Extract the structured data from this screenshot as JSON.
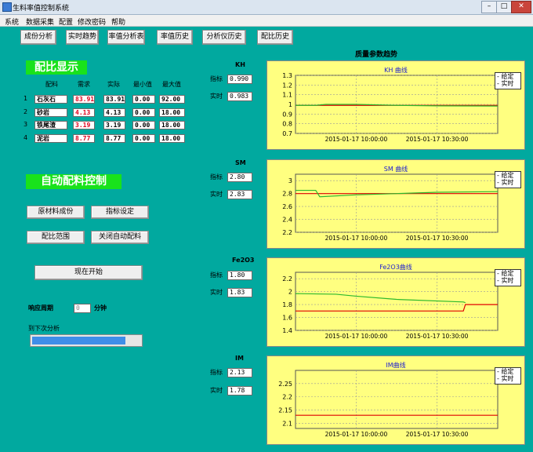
{
  "window": {
    "title": "生料率值控制系统",
    "min": "–",
    "max": "□",
    "close": "✕"
  },
  "menu": [
    "系统",
    "数据采集",
    "配置",
    "修改密码",
    "帮助"
  ],
  "toolbar": [
    "成份分析",
    "实时趋势",
    "率值分析表",
    "率值历史",
    "分析仪历史",
    "配比历史"
  ],
  "ratio": {
    "title": "配比显示",
    "headers": [
      "配料",
      "需求",
      "实际",
      "最小值",
      "最大值"
    ],
    "rows": [
      {
        "no": "1",
        "name": "石灰石",
        "demand": "83.91",
        "actual": "83.91",
        "min": "0.00",
        "max": "92.00"
      },
      {
        "no": "2",
        "name": "砂岩",
        "demand": "4.13",
        "actual": "4.13",
        "min": "0.00",
        "max": "18.00"
      },
      {
        "no": "3",
        "name": "铁尾渣",
        "demand": "3.19",
        "actual": "3.19",
        "min": "0.00",
        "max": "18.00"
      },
      {
        "no": "4",
        "name": "泥岩",
        "demand": "8.77",
        "actual": "8.77",
        "min": "0.00",
        "max": "18.00"
      }
    ]
  },
  "auto": {
    "title": "自动配料控制",
    "buttons": [
      "原材料成份",
      "指标设定",
      "配比范围",
      "关闭自动配料"
    ],
    "start": "现在开始",
    "period_label": "响应周期",
    "period_value": "0",
    "period_unit": "分钟",
    "next_label": "到下次分析",
    "progress": 0.88
  },
  "trend_title": "质量参数趋势",
  "panels": [
    {
      "param": "KH",
      "target_label": "指标",
      "target": "0.990",
      "actual_label": "实时",
      "actual": "0.983",
      "chart_title": "KH 曲线"
    },
    {
      "param": "SM",
      "target_label": "指标",
      "target": "2.80",
      "actual_label": "实时",
      "actual": "2.83",
      "chart_title": "SM 曲线"
    },
    {
      "param": "Fe2O3",
      "target_label": "指标",
      "target": "1.80",
      "actual_label": "实时",
      "actual": "1.83",
      "chart_title": "Fe2O3曲线"
    },
    {
      "param": "IM",
      "target_label": "指标",
      "target": "2.13",
      "actual_label": "实时",
      "actual": "1.78",
      "chart_title": "IM曲线"
    }
  ],
  "legend": {
    "target": "给定",
    "actual": "实时"
  },
  "colors": {
    "bg": "#01a99f",
    "chart_bg": "#ffff80",
    "target_line": "#e00000",
    "actual_line": "#2db92d",
    "heading": "#19e21b"
  },
  "chart_data": [
    {
      "type": "line",
      "title": "KH 曲线",
      "x": [
        "2015-01-17 10:00:00",
        "2015-01-17 10:30:00"
      ],
      "yticks": [
        "1.3",
        "1.2",
        "1.1",
        "1",
        "0.9",
        "0.8",
        "0.7"
      ],
      "ylim": [
        0.7,
        1.3
      ],
      "series": [
        {
          "name": "给定",
          "color": "#e00000",
          "values": [
            [
              0,
              0.99
            ],
            [
              1,
              0.99
            ]
          ]
        },
        {
          "name": "实时",
          "color": "#2db92d",
          "values": [
            [
              0,
              0.99
            ],
            [
              0.1,
              0.99
            ],
            [
              0.15,
              1.0
            ],
            [
              0.3,
              1.0
            ],
            [
              0.5,
              0.99
            ],
            [
              0.7,
              0.985
            ],
            [
              1,
              0.983
            ]
          ]
        }
      ]
    },
    {
      "type": "line",
      "title": "SM 曲线",
      "x": [
        "2015-01-17 10:00:00",
        "2015-01-17 10:30:00"
      ],
      "yticks": [
        "3",
        "2.8",
        "2.6",
        "2.4",
        "2.2"
      ],
      "ylim": [
        2.2,
        3.1
      ],
      "series": [
        {
          "name": "给定",
          "color": "#e00000",
          "values": [
            [
              0,
              2.8
            ],
            [
              1,
              2.8
            ]
          ]
        },
        {
          "name": "实时",
          "color": "#2db92d",
          "values": [
            [
              0,
              2.85
            ],
            [
              0.1,
              2.85
            ],
            [
              0.12,
              2.75
            ],
            [
              0.3,
              2.78
            ],
            [
              0.5,
              2.8
            ],
            [
              0.7,
              2.82
            ],
            [
              1,
              2.83
            ]
          ]
        }
      ]
    },
    {
      "type": "line",
      "title": "Fe2O3曲线",
      "x": [
        "2015-01-17 10:00:00",
        "2015-01-17 10:30:00"
      ],
      "yticks": [
        "2.2",
        "2",
        "1.8",
        "1.6",
        "1.4"
      ],
      "ylim": [
        1.4,
        2.3
      ],
      "series": [
        {
          "name": "给定",
          "color": "#e00000",
          "values": [
            [
              0,
              1.7
            ],
            [
              0.83,
              1.7
            ],
            [
              0.84,
              1.8
            ],
            [
              1,
              1.8
            ]
          ]
        },
        {
          "name": "实时",
          "color": "#2db92d",
          "values": [
            [
              0,
              1.97
            ],
            [
              0.2,
              1.96
            ],
            [
              0.3,
              1.93
            ],
            [
              0.5,
              1.88
            ],
            [
              0.83,
              1.84
            ],
            [
              0.84,
              1.83
            ]
          ]
        }
      ]
    },
    {
      "type": "line",
      "title": "IM曲线",
      "x": [
        "2015-01-17 10:00:00",
        "2015-01-17 10:30:00"
      ],
      "yticks": [
        "2.25",
        "2.2",
        "2.15",
        "2.1"
      ],
      "ylim": [
        2.08,
        2.3
      ],
      "series": [
        {
          "name": "给定",
          "color": "#e00000",
          "values": [
            [
              0,
              2.13
            ],
            [
              1,
              2.13
            ]
          ]
        }
      ]
    }
  ]
}
